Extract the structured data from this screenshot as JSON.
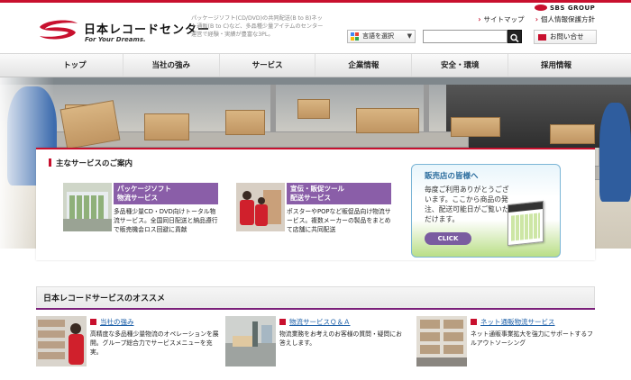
{
  "brand": {
    "name": "日本レコードセンター",
    "tagline": "For Your Dreams.",
    "intro": "パッケージソフト(CD/DVD)の共同配送(B to B)ネット通販(B to C)など、多品種少量アイテムのセンター運営で経験・実績が豊富な3PL。",
    "group": "SBS GROUP",
    "red": "#c8102e",
    "purple": "#8a5ea8"
  },
  "toplinks": [
    "サイトマップ",
    "個人情報保護方針"
  ],
  "language": {
    "label": "言語を選択"
  },
  "search": {
    "placeholder": ""
  },
  "contact": {
    "label": "お問い合せ"
  },
  "nav": [
    "トップ",
    "当社の強み",
    "サービス",
    "企業情報",
    "安全・環境",
    "採用情報"
  ],
  "services": {
    "title": "主なサービスのご案内",
    "items": [
      {
        "head": "パッケージソフト\n物流サービス",
        "text": "多品種少量CD・DVD向けトータル物流サービス。全国同日配送と納品遵行で販売機会ロス回避に貢献"
      },
      {
        "head": "宣伝・販促ツール\n配送サービス",
        "text": "ポスターやPOPなど販促品向け物流サービス。複数メーカーの製品をまとめて店舗に共同配送"
      }
    ]
  },
  "banner": {
    "title": "販売店の皆様へ",
    "text": "毎度ご利用ありがとうございます。ここから商品の発注、配送可能日がご覧いただけます。",
    "button": "CLICK"
  },
  "recommend": {
    "title": "日本レコードサービスのオススメ",
    "items": [
      {
        "head": "当社の強み",
        "text": "高精度な多品種少量物流のオペレーションを展開。グループ総合力でサービスメニューを充実。"
      },
      {
        "head": "物流サービスＱ＆Ａ",
        "text": "物流業務をお考えのお客様の質問・疑問にお答えします。"
      },
      {
        "head": "ネット通販物流サービス",
        "text": "ネット通販事業拡大を強力にサポートするフルアウトソーシング"
      }
    ]
  }
}
